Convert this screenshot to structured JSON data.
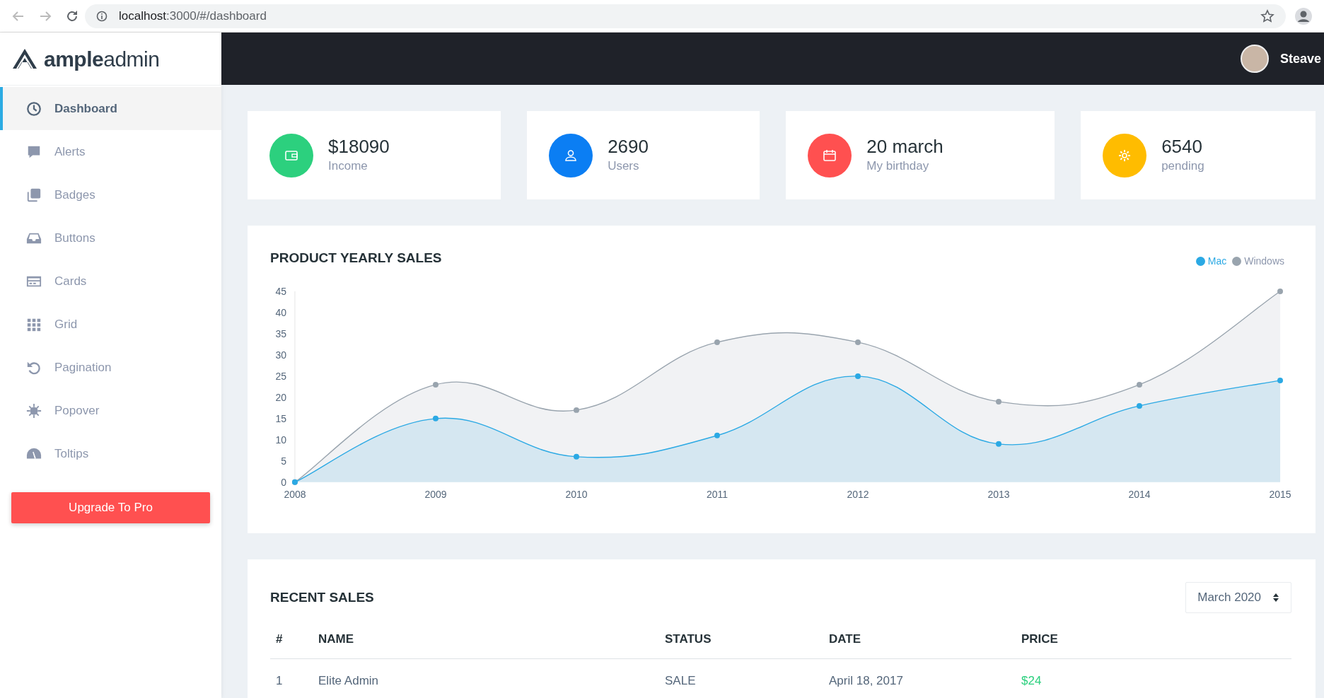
{
  "browser": {
    "url_host": "localhost",
    "url_rest": ":3000/#/dashboard"
  },
  "logo": {
    "bold": "ample",
    "light": "admin"
  },
  "user": {
    "name": "Steave"
  },
  "sidebar": {
    "items": [
      {
        "label": "Dashboard",
        "selected": true
      },
      {
        "label": "Alerts",
        "selected": false
      },
      {
        "label": "Badges",
        "selected": false
      },
      {
        "label": "Buttons",
        "selected": false
      },
      {
        "label": "Cards",
        "selected": false
      },
      {
        "label": "Grid",
        "selected": false
      },
      {
        "label": "Pagination",
        "selected": false
      },
      {
        "label": "Popover",
        "selected": false
      },
      {
        "label": "Toltips",
        "selected": false
      }
    ],
    "upgrade_button": "Upgrade To Pro"
  },
  "stats": [
    {
      "value": "$18090",
      "label": "Income",
      "color": "#2cd07e"
    },
    {
      "value": "2690",
      "label": "Users",
      "color": "#0b7ef3"
    },
    {
      "value": "20 march",
      "label": "My birthday",
      "color": "#ff5050"
    },
    {
      "value": "6540",
      "label": "pending",
      "color": "#ffbc00"
    }
  ],
  "sales_chart": {
    "title": "PRODUCT YEARLY SALES",
    "chart_data": {
      "type": "area",
      "categories": [
        "2008",
        "2009",
        "2010",
        "2011",
        "2012",
        "2013",
        "2014",
        "2015"
      ],
      "series": [
        {
          "name": "Mac",
          "color": "#2ba9e4",
          "values": [
            0,
            15,
            6,
            11,
            25,
            9,
            18,
            24
          ]
        },
        {
          "name": "Windows",
          "color": "#99a4ae",
          "values": [
            0,
            23,
            17,
            33,
            33,
            19,
            23,
            45
          ]
        }
      ],
      "ylim": [
        0,
        45
      ],
      "yticks": [
        0,
        5,
        10,
        15,
        20,
        25,
        30,
        35,
        40,
        45
      ]
    }
  },
  "recent_sales": {
    "title": "RECENT SALES",
    "period": "March 2020",
    "columns": [
      "#",
      "NAME",
      "STATUS",
      "DATE",
      "PRICE"
    ],
    "rows": [
      [
        "1",
        "Elite Admin",
        "SALE",
        "April 18, 2017",
        "$24"
      ]
    ]
  }
}
